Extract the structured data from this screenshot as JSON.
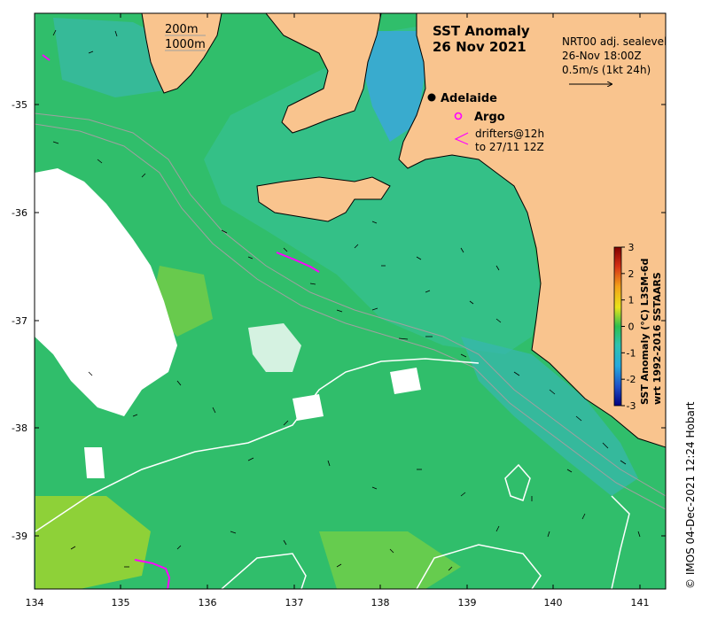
{
  "title": {
    "line1": "SST Anomaly",
    "line2": "26 Nov 2021"
  },
  "depth_legend": {
    "contour_a": "200m",
    "contour_b": "1000m"
  },
  "current_legend": {
    "line1": "NRT00 adj. sealevel",
    "line2": "26-Nov 18:00Z",
    "line3": "0.5m/s (1kt 24h)"
  },
  "places": {
    "city": "Adelaide"
  },
  "marker_legend": {
    "argo": "Argo",
    "drifters_line1": "drifters@12h",
    "drifters_line2": "to 27/11 12Z"
  },
  "colorbar": {
    "label_line1": "SST Anomaly (°C) L3SM-6d",
    "label_line2": "wrt 1992-2016 SSTAARS",
    "ticks": [
      "3",
      "2",
      "1",
      "0",
      "-1",
      "-2",
      "-3"
    ]
  },
  "axes": {
    "x_ticks": [
      "134",
      "135",
      "136",
      "137",
      "138",
      "139",
      "140",
      "141"
    ],
    "y_ticks": [
      "-35",
      "-36",
      "-37",
      "-38",
      "-39"
    ]
  },
  "credit": "© IMOS 04-Dec-2021 12:24 Hobart",
  "colors": {
    "land": "#f9c48e",
    "sea_anomaly_base": "#2fc06a",
    "cool_anomaly": "#2fb3c2",
    "warm_anomaly": "#a5d82a",
    "missing_data": "#ffffff",
    "argo_marker": "#ff00ff",
    "drifter_track": "#ff00ff",
    "depth_contour": "#a0a0a0",
    "anomaly_contour": "#ffffff"
  },
  "icons": {
    "city_marker": "filled-circle",
    "argo_marker": "open-circle",
    "drifter_marker": "open-chevron",
    "current_vector": "arrow"
  }
}
